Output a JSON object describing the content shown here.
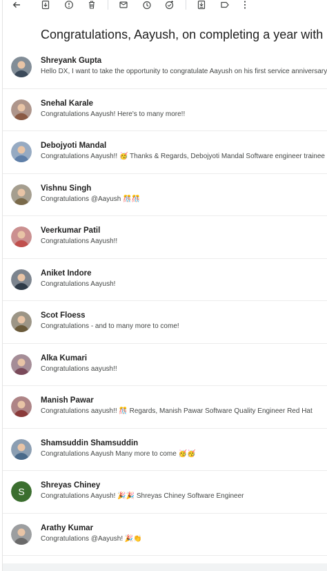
{
  "toolbar": {
    "icons": [
      "back-arrow-icon",
      "archive-icon",
      "report-spam-icon",
      "delete-icon",
      "mark-unread-icon",
      "snooze-icon",
      "add-task-icon",
      "move-to-icon",
      "label-icon",
      "more-vert-icon"
    ]
  },
  "thread": {
    "subject": "Congratulations, Aayush, on completing a year with us!"
  },
  "messages": [
    {
      "sender": "Shreyank Gupta",
      "snippet": "Hello DX, I want to take the opportunity to congratulate Aayush on his first service anniversary w",
      "avatar_color": "#3b4a5a"
    },
    {
      "sender": "Snehal Karale",
      "snippet": "Congratulations Aayush! Here's to many more!!",
      "avatar_color": "#8a5a44"
    },
    {
      "sender": "Debojyoti Mandal",
      "snippet": "Congratulations Aayush!! 🥳 Thanks & Regards, Debojyoti Mandal Software engineer trainee P",
      "avatar_color": "#5f7fa8"
    },
    {
      "sender": "Vishnu Singh",
      "snippet": "Congratulations @Aayush 🎊🎊",
      "avatar_color": "#7a6a4a"
    },
    {
      "sender": "Veerkumar Patil",
      "snippet": "Congratulations Aayush!!",
      "avatar_color": "#c0504d"
    },
    {
      "sender": "Aniket Indore",
      "snippet": "Congratulations Aayush!",
      "avatar_color": "#2f3b48"
    },
    {
      "sender": "Scot Floess",
      "snippet": "Congratulations - and to many more to come!",
      "avatar_color": "#6a5a3a"
    },
    {
      "sender": "Alka Kumari",
      "snippet": "Congratulations aayush!!",
      "avatar_color": "#7a4a5a"
    },
    {
      "sender": "Manish Pawar",
      "snippet": "Congratulations aayush!! 🎊 Regards, Manish Pawar Software Quality Engineer Red Hat",
      "avatar_color": "#8a3a3a"
    },
    {
      "sender": "Shamsuddin Shamsuddin",
      "snippet": "Congratulations Aayush Many more to come 🥳🥳",
      "avatar_color": "#4a6a8a"
    },
    {
      "sender": "Shreyas Chiney",
      "snippet": "Congratulations Aayush! 🎉🎉 Shreyas Chiney Software Engineer",
      "avatar_color": "#3b6e2f",
      "avatar_letter": "S"
    },
    {
      "sender": "Arathy Kumar",
      "snippet": "Congratulations @Aayush! 🎉👏",
      "avatar_color": "#6a6a6a"
    }
  ]
}
